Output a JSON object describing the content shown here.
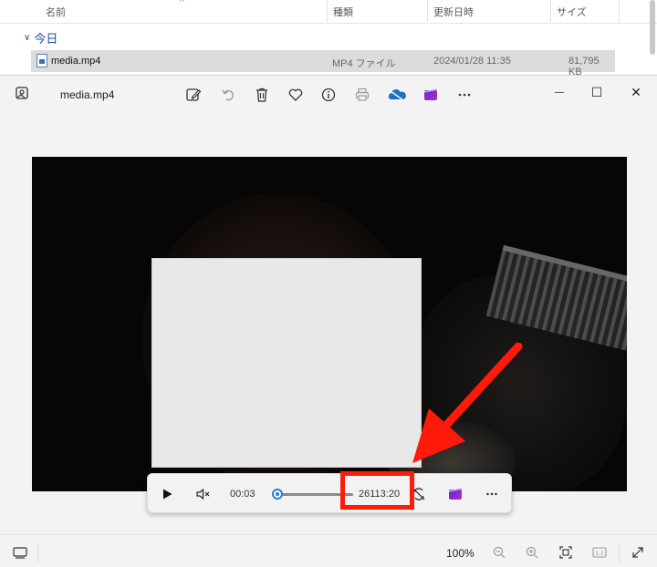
{
  "explorer": {
    "columns": {
      "name": "名前",
      "type": "種類",
      "modified": "更新日時",
      "size": "サイズ"
    },
    "group_label": "今日",
    "file": {
      "name": "media.mp4",
      "type": "MP4 ファイル",
      "modified": "2024/01/28 11:35",
      "size": "81,795 KB"
    }
  },
  "viewer": {
    "title": "media.mp4",
    "toolbar_icons": [
      "edit-icon",
      "rotate-icon",
      "delete-icon",
      "favorite-icon",
      "info-icon",
      "print-icon",
      "onedrive-icon",
      "clipchamp-icon",
      "more-icon"
    ],
    "window_controls": {
      "minimize": "—",
      "maximize": "☐",
      "close": "✕"
    }
  },
  "player": {
    "elapsed": "00:03",
    "remaining": "26113:20",
    "progress": 0.0
  },
  "status": {
    "zoom": "100%"
  },
  "colors": {
    "accent": "#2b7cd3",
    "highlight": "#ff1a0a"
  }
}
